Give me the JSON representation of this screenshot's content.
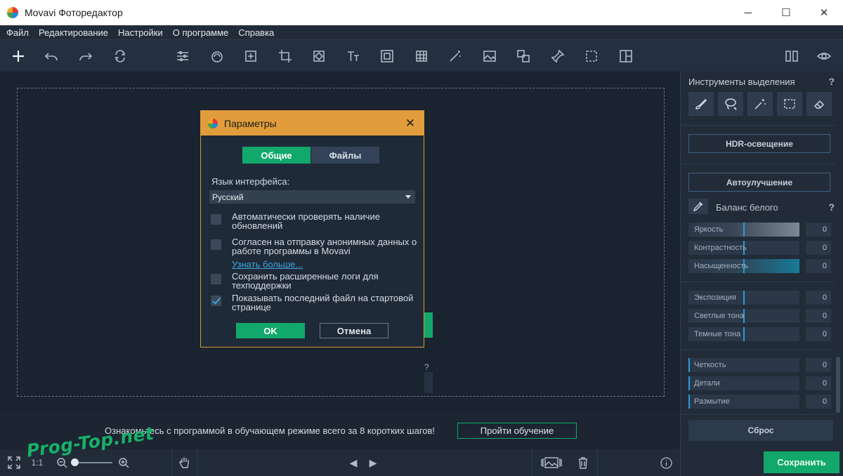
{
  "window": {
    "title": "Movavi Фоторедактор"
  },
  "menu": [
    "Файл",
    "Редактирование",
    "Настройки",
    "О программе",
    "Справка"
  ],
  "workspace": {
    "hint_char": "?"
  },
  "tutorial": {
    "message": "Ознакомьтесь с программой в обучающем режиме всего за 8 коротких шагов!",
    "button": "Пройти обучение"
  },
  "bottombar": {
    "zoom_ratio": "1:1",
    "zoom_level": 0
  },
  "watermark": "Prog-Top.net",
  "right_panel": {
    "selection_title": "Инструменты выделения",
    "help": "?",
    "hdr_button": "HDR-освещение",
    "auto_button": "Автоулучшение",
    "white_balance": "Баланс белого",
    "sliders_color": [
      {
        "label": "Яркость",
        "value": "0"
      },
      {
        "label": "Контрастность",
        "value": "0"
      },
      {
        "label": "Насыщенность",
        "value": "0"
      }
    ],
    "sliders_tone": [
      {
        "label": "Экспозиция",
        "value": "0"
      },
      {
        "label": "Светлые тона",
        "value": "0"
      },
      {
        "label": "Темные тона",
        "value": "0"
      }
    ],
    "sliders_detail": [
      {
        "label": "Четкость",
        "value": "0"
      },
      {
        "label": "Детали",
        "value": "0"
      },
      {
        "label": "Размытие",
        "value": "0"
      }
    ],
    "reset_button": "Сброс",
    "save_button": "Сохранить"
  },
  "dialog": {
    "title": "Параметры",
    "close": "✕",
    "tabs": [
      "Общие",
      "Файлы"
    ],
    "language_label": "Язык интерфейса:",
    "language_value": "Русский",
    "options": [
      {
        "text": "Автоматически проверять наличие обновлений",
        "checked": false
      },
      {
        "text": "Согласен на отправку анонимных данных о работе программы в Movavi",
        "checked": false
      },
      {
        "text": "Сохранить расширенные логи для техподдержки",
        "checked": false
      },
      {
        "text": "Показывать последний файл на стартовой странице",
        "checked": true
      }
    ],
    "learn_more": "Узнать больше...",
    "ok": "OK",
    "cancel": "Отмена"
  },
  "colors": {
    "accent": "#13a86b",
    "dialog_title": "#e19d3b",
    "link": "#3ca8e0"
  }
}
